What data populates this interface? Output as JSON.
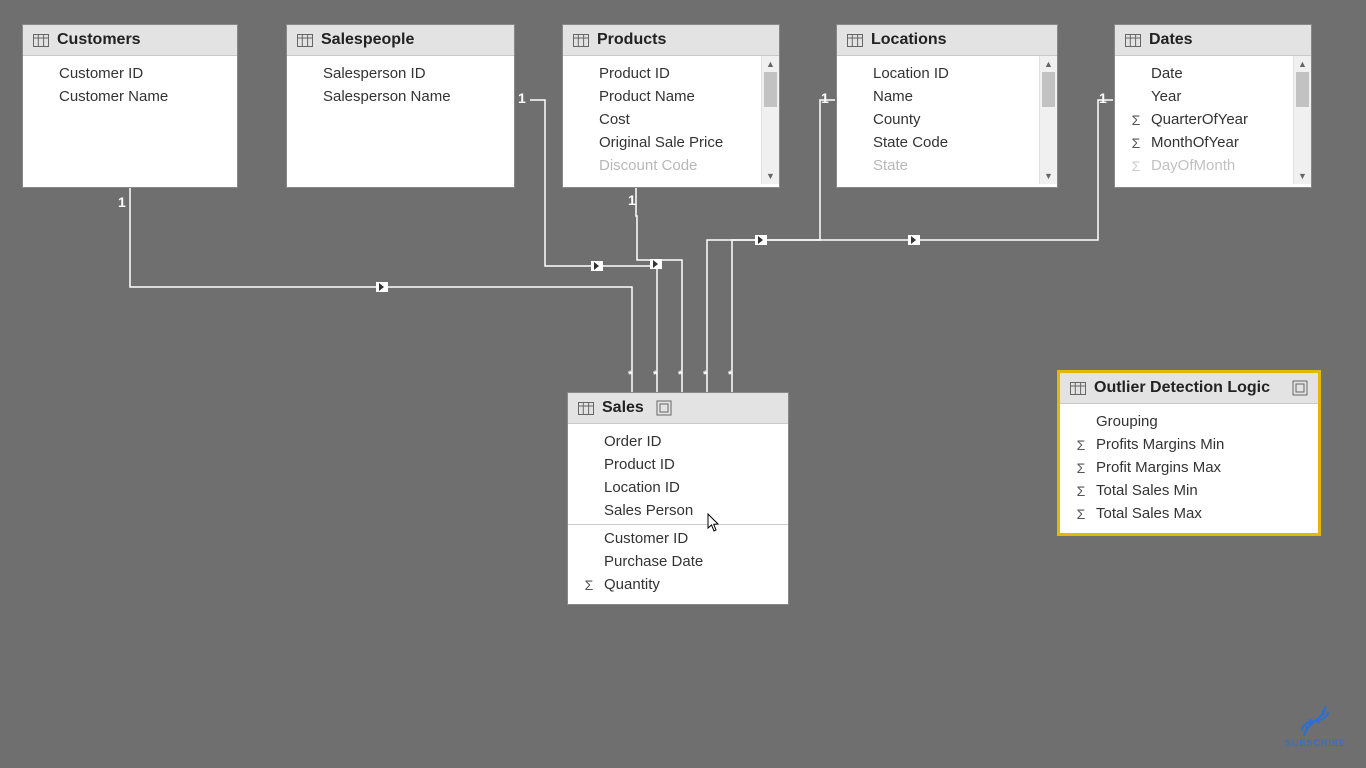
{
  "tables": {
    "customers": {
      "title": "Customers",
      "fields": [
        {
          "label": "Customer ID",
          "icon": "none"
        },
        {
          "label": "Customer Name",
          "icon": "none"
        }
      ]
    },
    "salespeople": {
      "title": "Salespeople",
      "fields": [
        {
          "label": "Salesperson ID",
          "icon": "none"
        },
        {
          "label": "Salesperson Name",
          "icon": "none"
        }
      ]
    },
    "products": {
      "title": "Products",
      "scroll": true,
      "fields": [
        {
          "label": "Product ID",
          "icon": "none"
        },
        {
          "label": "Product Name",
          "icon": "none"
        },
        {
          "label": "Cost",
          "icon": "none"
        },
        {
          "label": "Original Sale Price",
          "icon": "none"
        },
        {
          "label": "Discount Code",
          "icon": "none",
          "cut": true
        }
      ]
    },
    "locations": {
      "title": "Locations",
      "scroll": true,
      "fields": [
        {
          "label": "Location ID",
          "icon": "none"
        },
        {
          "label": "Name",
          "icon": "none"
        },
        {
          "label": "County",
          "icon": "none"
        },
        {
          "label": "State Code",
          "icon": "none"
        },
        {
          "label": "State",
          "icon": "none",
          "cut": true
        }
      ]
    },
    "dates": {
      "title": "Dates",
      "scroll": true,
      "fields": [
        {
          "label": "Date",
          "icon": "none"
        },
        {
          "label": "Year",
          "icon": "none"
        },
        {
          "label": "QuarterOfYear",
          "icon": "sigma"
        },
        {
          "label": "MonthOfYear",
          "icon": "sigma"
        },
        {
          "label": "DayOfMonth",
          "icon": "sigma",
          "cut": true
        }
      ]
    },
    "sales": {
      "title": "Sales",
      "fields": [
        {
          "label": "Order ID",
          "icon": "none"
        },
        {
          "label": "Product ID",
          "icon": "none"
        },
        {
          "label": "Location ID",
          "icon": "none"
        },
        {
          "label": "Sales Person",
          "icon": "none"
        },
        {
          "sep": true
        },
        {
          "label": "Customer ID",
          "icon": "none"
        },
        {
          "label": "Purchase Date",
          "icon": "none"
        },
        {
          "label": "Quantity",
          "icon": "sigma"
        }
      ]
    },
    "outlier": {
      "title": "Outlier Detection Logic",
      "selected": true,
      "fields": [
        {
          "label": "Grouping",
          "icon": "none"
        },
        {
          "label": "Profits Margins Min",
          "icon": "sigma"
        },
        {
          "label": "Profit Margins Max",
          "icon": "sigma"
        },
        {
          "label": "Total Sales Min",
          "icon": "sigma"
        },
        {
          "label": "Total Sales Max",
          "icon": "sigma"
        }
      ]
    }
  },
  "cardinality": {
    "one": "1",
    "many": "*"
  },
  "subscribe_label": "SUBSCRIBE"
}
